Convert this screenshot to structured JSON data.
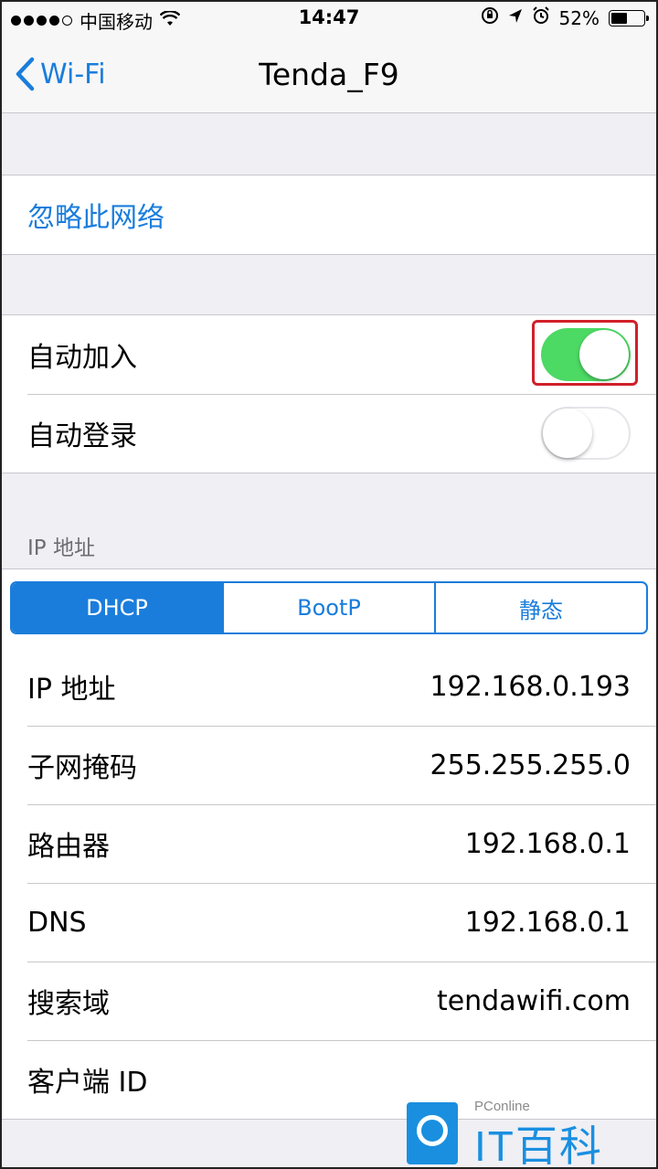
{
  "status_bar": {
    "carrier": "中国移动",
    "time": "14:47",
    "battery": "52%",
    "battery_level": 0.52,
    "icons": [
      "signal-dots-icon",
      "wifi-icon",
      "rotation-lock-icon",
      "location-icon",
      "alarm-icon",
      "battery-icon"
    ]
  },
  "nav": {
    "back_label": "Wi-Fi",
    "title": "Tenda_F9"
  },
  "forget": {
    "label": "忽略此网络"
  },
  "toggles": {
    "auto_join": {
      "label": "自动加入",
      "on": true
    },
    "auto_login": {
      "label": "自动登录",
      "on": false
    }
  },
  "ip_section": {
    "header": "IP 地址",
    "segments": [
      "DHCP",
      "BootP",
      "静态"
    ],
    "selected": "DHCP"
  },
  "details": [
    {
      "label": "IP 地址",
      "value": "192.168.0.193"
    },
    {
      "label": "子网掩码",
      "value": "255.255.255.0"
    },
    {
      "label": "路由器",
      "value": "192.168.0.1"
    },
    {
      "label": "DNS",
      "value": "192.168.0.1"
    },
    {
      "label": "搜索域",
      "value": "tendawifi.com"
    },
    {
      "label": "客户端 ID",
      "value": ""
    }
  ],
  "watermark": {
    "small": "PConline",
    "big": "IT百科"
  },
  "colors": {
    "accent": "#1a7ddc",
    "toggle_on": "#4cd964",
    "highlight": "#d0202a"
  }
}
